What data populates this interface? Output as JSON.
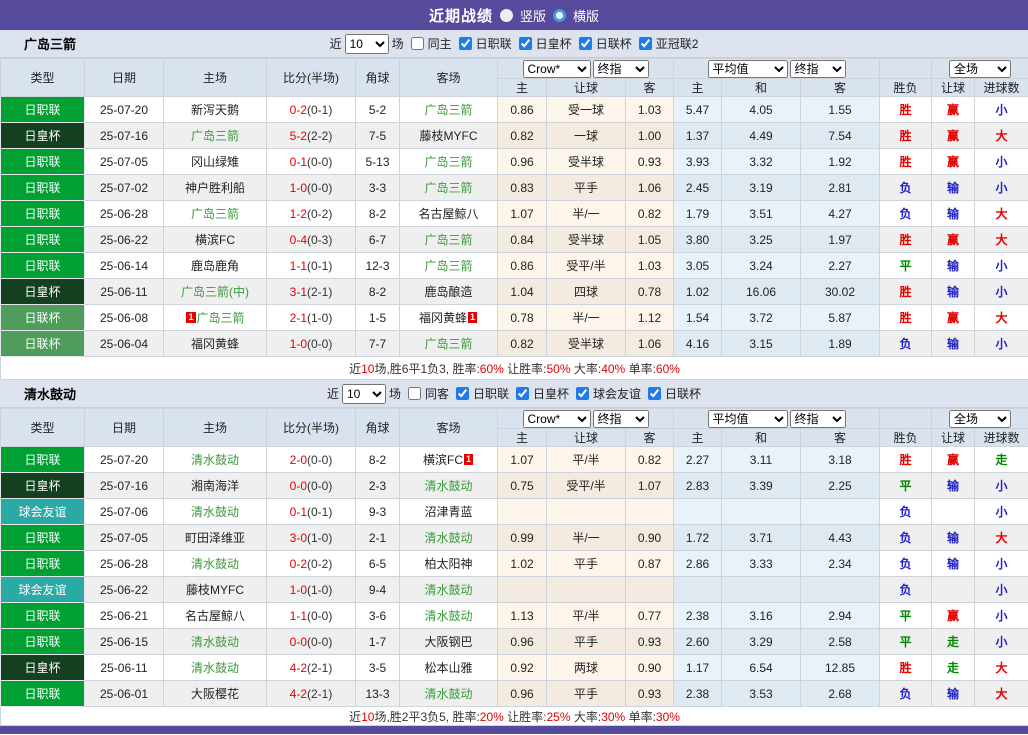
{
  "topbar": {
    "title": "近期战绩",
    "vertical_label": "竖版",
    "horizontal_label": "横版"
  },
  "colors": {
    "accent_purple": "#564A9C",
    "team_green": "#3A9A3A",
    "score_red": "#E60000",
    "leagues": {
      "日职联": "#00A033",
      "日皇杯": "#15401F",
      "日联杯": "#4F9C5B",
      "球会友谊": "#2BA9A4"
    },
    "result": {
      "胜": "#E60000",
      "负": "#2222CC",
      "平": "#008800",
      "赢": "#E60000",
      "输": "#2222CC",
      "走": "#008800",
      "大": "#E60000",
      "小": "#2222CC"
    }
  },
  "table": {
    "left_headers": [
      "类型",
      "日期",
      "主场",
      "比分(半场)",
      "角球",
      "客场"
    ],
    "odds_headers": [
      "主",
      "让球",
      "客",
      "主",
      "和",
      "客",
      "胜负",
      "让球",
      "进球数"
    ],
    "selects": {
      "company": "Crow*",
      "company_index": "终指",
      "average": "平均值",
      "average_index": "终指",
      "scope": "全场"
    }
  },
  "sections": [
    {
      "team": "广岛三箭",
      "filter": {
        "near_label": "近",
        "matches": "10",
        "unit_label": "场",
        "same_label": "同主",
        "same_checked": false,
        "leagues": [
          "日职联",
          "日皇杯",
          "日联杯",
          "亚冠联2"
        ]
      },
      "rows": [
        {
          "league": "日职联",
          "date": "25-07-20",
          "home": "新泻天鹅",
          "home_focus": false,
          "home_badge": "",
          "score": "0-2",
          "half": "(0-1)",
          "corner": "5-2",
          "away": "广岛三箭",
          "away_focus": true,
          "away_badge": "",
          "odds": [
            "0.86",
            "受一球",
            "1.03"
          ],
          "avg": [
            "5.47",
            "4.05",
            "1.55"
          ],
          "res": [
            "胜",
            "赢",
            "小"
          ]
        },
        {
          "league": "日皇杯",
          "date": "25-07-16",
          "home": "广岛三箭",
          "home_focus": true,
          "home_badge": "",
          "score": "5-2",
          "half": "(2-2)",
          "corner": "7-5",
          "away": "藤枝MYFC",
          "away_focus": false,
          "away_badge": "",
          "odds": [
            "0.82",
            "一球",
            "1.00"
          ],
          "avg": [
            "1.37",
            "4.49",
            "7.54"
          ],
          "res": [
            "胜",
            "赢",
            "大"
          ]
        },
        {
          "league": "日职联",
          "date": "25-07-05",
          "home": "冈山绿雉",
          "home_focus": false,
          "home_badge": "",
          "score": "0-1",
          "half": "(0-0)",
          "corner": "5-13",
          "away": "广岛三箭",
          "away_focus": true,
          "away_badge": "",
          "odds": [
            "0.96",
            "受半球",
            "0.93"
          ],
          "avg": [
            "3.93",
            "3.32",
            "1.92"
          ],
          "res": [
            "胜",
            "赢",
            "小"
          ]
        },
        {
          "league": "日职联",
          "date": "25-07-02",
          "home": "神户胜利船",
          "home_focus": false,
          "home_badge": "",
          "score": "1-0",
          "half": "(0-0)",
          "corner": "3-3",
          "away": "广岛三箭",
          "away_focus": true,
          "away_badge": "",
          "odds": [
            "0.83",
            "平手",
            "1.06"
          ],
          "avg": [
            "2.45",
            "3.19",
            "2.81"
          ],
          "res": [
            "负",
            "输",
            "小"
          ]
        },
        {
          "league": "日职联",
          "date": "25-06-28",
          "home": "广岛三箭",
          "home_focus": true,
          "home_badge": "",
          "score": "1-2",
          "half": "(0-2)",
          "corner": "8-2",
          "away": "名古屋鲸八",
          "away_focus": false,
          "away_badge": "",
          "odds": [
            "1.07",
            "半/一",
            "0.82"
          ],
          "avg": [
            "1.79",
            "3.51",
            "4.27"
          ],
          "res": [
            "负",
            "输",
            "大"
          ]
        },
        {
          "league": "日职联",
          "date": "25-06-22",
          "home": "横滨FC",
          "home_focus": false,
          "home_badge": "",
          "score": "0-4",
          "half": "(0-3)",
          "corner": "6-7",
          "away": "广岛三箭",
          "away_focus": true,
          "away_badge": "",
          "odds": [
            "0.84",
            "受半球",
            "1.05"
          ],
          "avg": [
            "3.80",
            "3.25",
            "1.97"
          ],
          "res": [
            "胜",
            "赢",
            "大"
          ]
        },
        {
          "league": "日职联",
          "date": "25-06-14",
          "home": "鹿岛鹿角",
          "home_focus": false,
          "home_badge": "",
          "score": "1-1",
          "half": "(0-1)",
          "corner": "12-3",
          "away": "广岛三箭",
          "away_focus": true,
          "away_badge": "",
          "odds": [
            "0.86",
            "受平/半",
            "1.03"
          ],
          "avg": [
            "3.05",
            "3.24",
            "2.27"
          ],
          "res": [
            "平",
            "输",
            "小"
          ]
        },
        {
          "league": "日皇杯",
          "date": "25-06-11",
          "home": "广岛三箭(中)",
          "home_focus": true,
          "home_badge": "",
          "score": "3-1",
          "half": "(2-1)",
          "corner": "8-2",
          "away": "鹿岛酿造",
          "away_focus": false,
          "away_badge": "",
          "odds": [
            "1.04",
            "四球",
            "0.78"
          ],
          "avg": [
            "1.02",
            "16.06",
            "30.02"
          ],
          "res": [
            "胜",
            "输",
            "小"
          ]
        },
        {
          "league": "日联杯",
          "date": "25-06-08",
          "home": "广岛三箭",
          "home_focus": true,
          "home_badge": "1",
          "score": "2-1",
          "half": "(1-0)",
          "corner": "1-5",
          "away": "福冈黄蜂",
          "away_focus": false,
          "away_badge": "1",
          "odds": [
            "0.78",
            "半/一",
            "1.12"
          ],
          "avg": [
            "1.54",
            "3.72",
            "5.87"
          ],
          "res": [
            "胜",
            "赢",
            "大"
          ]
        },
        {
          "league": "日联杯",
          "date": "25-06-04",
          "home": "福冈黄蜂",
          "home_focus": false,
          "home_badge": "",
          "score": "1-0",
          "half": "(0-0)",
          "corner": "7-7",
          "away": "广岛三箭",
          "away_focus": true,
          "away_badge": "",
          "odds": [
            "0.82",
            "受半球",
            "1.06"
          ],
          "avg": [
            "4.16",
            "3.15",
            "1.89"
          ],
          "res": [
            "负",
            "输",
            "小"
          ]
        }
      ],
      "summary": [
        {
          "t": "近",
          "r": false
        },
        {
          "t": "10",
          "r": true
        },
        {
          "t": "场,胜6平1负3, 胜率:",
          "r": false
        },
        {
          "t": "60%",
          "r": true
        },
        {
          "t": " 让胜率:",
          "r": false
        },
        {
          "t": "50%",
          "r": true
        },
        {
          "t": " 大率:",
          "r": false
        },
        {
          "t": "40%",
          "r": true
        },
        {
          "t": " 单率:",
          "r": false
        },
        {
          "t": "60%",
          "r": true
        }
      ]
    },
    {
      "team": "清水鼓动",
      "filter": {
        "near_label": "近",
        "matches": "10",
        "unit_label": "场",
        "same_label": "同客",
        "same_checked": false,
        "leagues": [
          "日职联",
          "日皇杯",
          "球会友谊",
          "日联杯"
        ]
      },
      "rows": [
        {
          "league": "日职联",
          "date": "25-07-20",
          "home": "清水鼓动",
          "home_focus": true,
          "home_badge": "",
          "score": "2-0",
          "half": "(0-0)",
          "corner": "8-2",
          "away": "横滨FC",
          "away_focus": false,
          "away_badge": "1",
          "odds": [
            "1.07",
            "平/半",
            "0.82"
          ],
          "avg": [
            "2.27",
            "3.11",
            "3.18"
          ],
          "res": [
            "胜",
            "赢",
            "走"
          ]
        },
        {
          "league": "日皇杯",
          "date": "25-07-16",
          "home": "湘南海洋",
          "home_focus": false,
          "home_badge": "",
          "score": "0-0",
          "half": "(0-0)",
          "corner": "2-3",
          "away": "清水鼓动",
          "away_focus": true,
          "away_badge": "",
          "odds": [
            "0.75",
            "受平/半",
            "1.07"
          ],
          "avg": [
            "2.83",
            "3.39",
            "2.25"
          ],
          "res": [
            "平",
            "输",
            "小"
          ]
        },
        {
          "league": "球会友谊",
          "date": "25-07-06",
          "home": "清水鼓动",
          "home_focus": true,
          "home_badge": "",
          "score": "0-1",
          "half": "(0-1)",
          "corner": "9-3",
          "away": "沼津青蓝",
          "away_focus": false,
          "away_badge": "",
          "odds": [
            "",
            "",
            ""
          ],
          "avg": [
            "",
            "",
            ""
          ],
          "res": [
            "负",
            "",
            "小"
          ]
        },
        {
          "league": "日职联",
          "date": "25-07-05",
          "home": "町田泽维亚",
          "home_focus": false,
          "home_badge": "",
          "score": "3-0",
          "half": "(1-0)",
          "corner": "2-1",
          "away": "清水鼓动",
          "away_focus": true,
          "away_badge": "",
          "odds": [
            "0.99",
            "半/一",
            "0.90"
          ],
          "avg": [
            "1.72",
            "3.71",
            "4.43"
          ],
          "res": [
            "负",
            "输",
            "大"
          ]
        },
        {
          "league": "日职联",
          "date": "25-06-28",
          "home": "清水鼓动",
          "home_focus": true,
          "home_badge": "",
          "score": "0-2",
          "half": "(0-2)",
          "corner": "6-5",
          "away": "柏太阳神",
          "away_focus": false,
          "away_badge": "",
          "odds": [
            "1.02",
            "平手",
            "0.87"
          ],
          "avg": [
            "2.86",
            "3.33",
            "2.34"
          ],
          "res": [
            "负",
            "输",
            "小"
          ]
        },
        {
          "league": "球会友谊",
          "date": "25-06-22",
          "home": "藤枝MYFC",
          "home_focus": false,
          "home_badge": "",
          "score": "1-0",
          "half": "(1-0)",
          "corner": "9-4",
          "away": "清水鼓动",
          "away_focus": true,
          "away_badge": "",
          "odds": [
            "",
            "",
            ""
          ],
          "avg": [
            "",
            "",
            ""
          ],
          "res": [
            "负",
            "",
            "小"
          ]
        },
        {
          "league": "日职联",
          "date": "25-06-21",
          "home": "名古屋鲸八",
          "home_focus": false,
          "home_badge": "",
          "score": "1-1",
          "half": "(0-0)",
          "corner": "3-6",
          "away": "清水鼓动",
          "away_focus": true,
          "away_badge": "",
          "odds": [
            "1.13",
            "平/半",
            "0.77"
          ],
          "avg": [
            "2.38",
            "3.16",
            "2.94"
          ],
          "res": [
            "平",
            "赢",
            "小"
          ]
        },
        {
          "league": "日职联",
          "date": "25-06-15",
          "home": "清水鼓动",
          "home_focus": true,
          "home_badge": "",
          "score": "0-0",
          "half": "(0-0)",
          "corner": "1-7",
          "away": "大阪钢巴",
          "away_focus": false,
          "away_badge": "",
          "odds": [
            "0.96",
            "平手",
            "0.93"
          ],
          "avg": [
            "2.60",
            "3.29",
            "2.58"
          ],
          "res": [
            "平",
            "走",
            "小"
          ]
        },
        {
          "league": "日皇杯",
          "date": "25-06-11",
          "home": "清水鼓动",
          "home_focus": true,
          "home_badge": "",
          "score": "4-2",
          "half": "(2-1)",
          "corner": "3-5",
          "away": "松本山雅",
          "away_focus": false,
          "away_badge": "",
          "odds": [
            "0.92",
            "两球",
            "0.90"
          ],
          "avg": [
            "1.17",
            "6.54",
            "12.85"
          ],
          "res": [
            "胜",
            "走",
            "大"
          ]
        },
        {
          "league": "日职联",
          "date": "25-06-01",
          "home": "大阪樱花",
          "home_focus": false,
          "home_badge": "",
          "score": "4-2",
          "half": "(2-1)",
          "corner": "13-3",
          "away": "清水鼓动",
          "away_focus": true,
          "away_badge": "",
          "odds": [
            "0.96",
            "平手",
            "0.93"
          ],
          "avg": [
            "2.38",
            "3.53",
            "2.68"
          ],
          "res": [
            "负",
            "输",
            "大"
          ]
        }
      ],
      "summary": [
        {
          "t": "近",
          "r": false
        },
        {
          "t": "10",
          "r": true
        },
        {
          "t": "场,胜2平3负5, 胜率:",
          "r": false
        },
        {
          "t": "20%",
          "r": true
        },
        {
          "t": " 让胜率:",
          "r": false
        },
        {
          "t": "25%",
          "r": true
        },
        {
          "t": " 大率:",
          "r": false
        },
        {
          "t": "30%",
          "r": true
        },
        {
          "t": " 单率:",
          "r": false
        },
        {
          "t": "30%",
          "r": true
        }
      ]
    }
  ]
}
